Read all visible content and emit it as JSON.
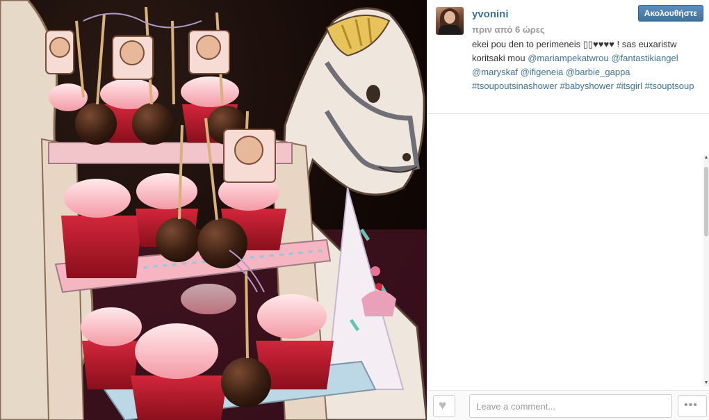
{
  "post": {
    "username": "yvonini",
    "timestamp": "πριν από 6 ώρες",
    "follow_label": "Ακολουθήστε",
    "caption": [
      {
        "type": "plain",
        "text": "ekei pou den to perimeneis ▯▯♥♥♥♥ ! sas euxaristw koritsaki mou "
      },
      {
        "type": "mention",
        "text": "@mariampekatwrou"
      },
      {
        "type": "plain",
        "text": " "
      },
      {
        "type": "mention",
        "text": "@fantastikiangel"
      },
      {
        "type": "plain",
        "text": " "
      },
      {
        "type": "mention",
        "text": "@maryskaf"
      },
      {
        "type": "plain",
        "text": " "
      },
      {
        "type": "mention",
        "text": "@ifigeneia"
      },
      {
        "type": "plain",
        "text": " "
      },
      {
        "type": "mention",
        "text": "@barbie_gappa"
      },
      {
        "type": "plain",
        "text": " "
      },
      {
        "type": "tag",
        "text": "#tsoupoutsinashower"
      },
      {
        "type": "plain",
        "text": " "
      },
      {
        "type": "tag",
        "text": "#babyshower"
      },
      {
        "type": "plain",
        "text": " "
      },
      {
        "type": "tag",
        "text": "#itsgirl"
      },
      {
        "type": "plain",
        "text": " "
      },
      {
        "type": "tag",
        "text": "#tsouptsoup"
      }
    ]
  },
  "footer": {
    "comment_placeholder": "Leave a comment...",
    "like_icon": "heart-icon",
    "more_icon": "ellipsis-icon",
    "heart_glyph": "♥",
    "dots_glyph": "•••"
  },
  "colors": {
    "link": "#3f729b",
    "follow_button": "#3f729b",
    "timestamp": "#999999"
  }
}
